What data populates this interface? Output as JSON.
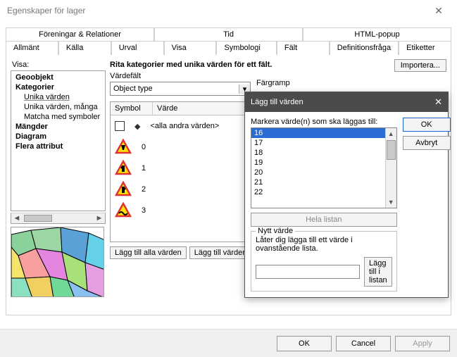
{
  "window": {
    "title": "Egenskaper för lager"
  },
  "tabs_top": [
    "Föreningar & Relationer",
    "Tid",
    "HTML-popup"
  ],
  "tabs_bottom": [
    "Allmänt",
    "Källa",
    "Urval",
    "Visa",
    "Symbologi",
    "Fält",
    "Definitionsfråga",
    "Etiketter"
  ],
  "active_tab": "Symbologi",
  "left": {
    "label": "Visa:",
    "tree": {
      "geoobjekt": "Geoobjekt",
      "kategorier": "Kategorier",
      "unika": "Unika värden",
      "unika_manga": "Unika värden, många",
      "matcha": "Matcha med symboler",
      "mangder": "Mängder",
      "diagram": "Diagram",
      "flera": "Flera attribut"
    }
  },
  "right": {
    "heading": "Rita kategorier med unika värden för ett fält.",
    "vardefalt_label": "Värdefält",
    "vardefalt_value": "Object type",
    "fargramp_label": "Färgramp",
    "import_btn": "Importera...",
    "table": {
      "col_symbol": "Symbol",
      "col_varde": "Värde",
      "all_other": "<alla andra värden>",
      "rows": [
        {
          "value": "0"
        },
        {
          "value": "1"
        },
        {
          "value": "2"
        },
        {
          "value": "3"
        }
      ]
    },
    "btn_all": "Lägg till alla värden",
    "btn_add": "Lägg till värden..."
  },
  "modal": {
    "title": "Lägg till värden",
    "mark_label": "Markera värde(n) som ska läggas till:",
    "items": [
      "16",
      "17",
      "18",
      "19",
      "20",
      "21",
      "22"
    ],
    "selected": "16",
    "ok": "OK",
    "cancel": "Avbryt",
    "hela_listan": "Hela listan",
    "newvalue_legend": "Nytt värde",
    "newvalue_desc": "Låter dig lägga till ett värde i ovanstående lista.",
    "newvalue_btn": "Lägg till i listan",
    "newvalue_input": ""
  },
  "footer": {
    "ok": "OK",
    "cancel": "Cancel",
    "apply": "Apply"
  }
}
